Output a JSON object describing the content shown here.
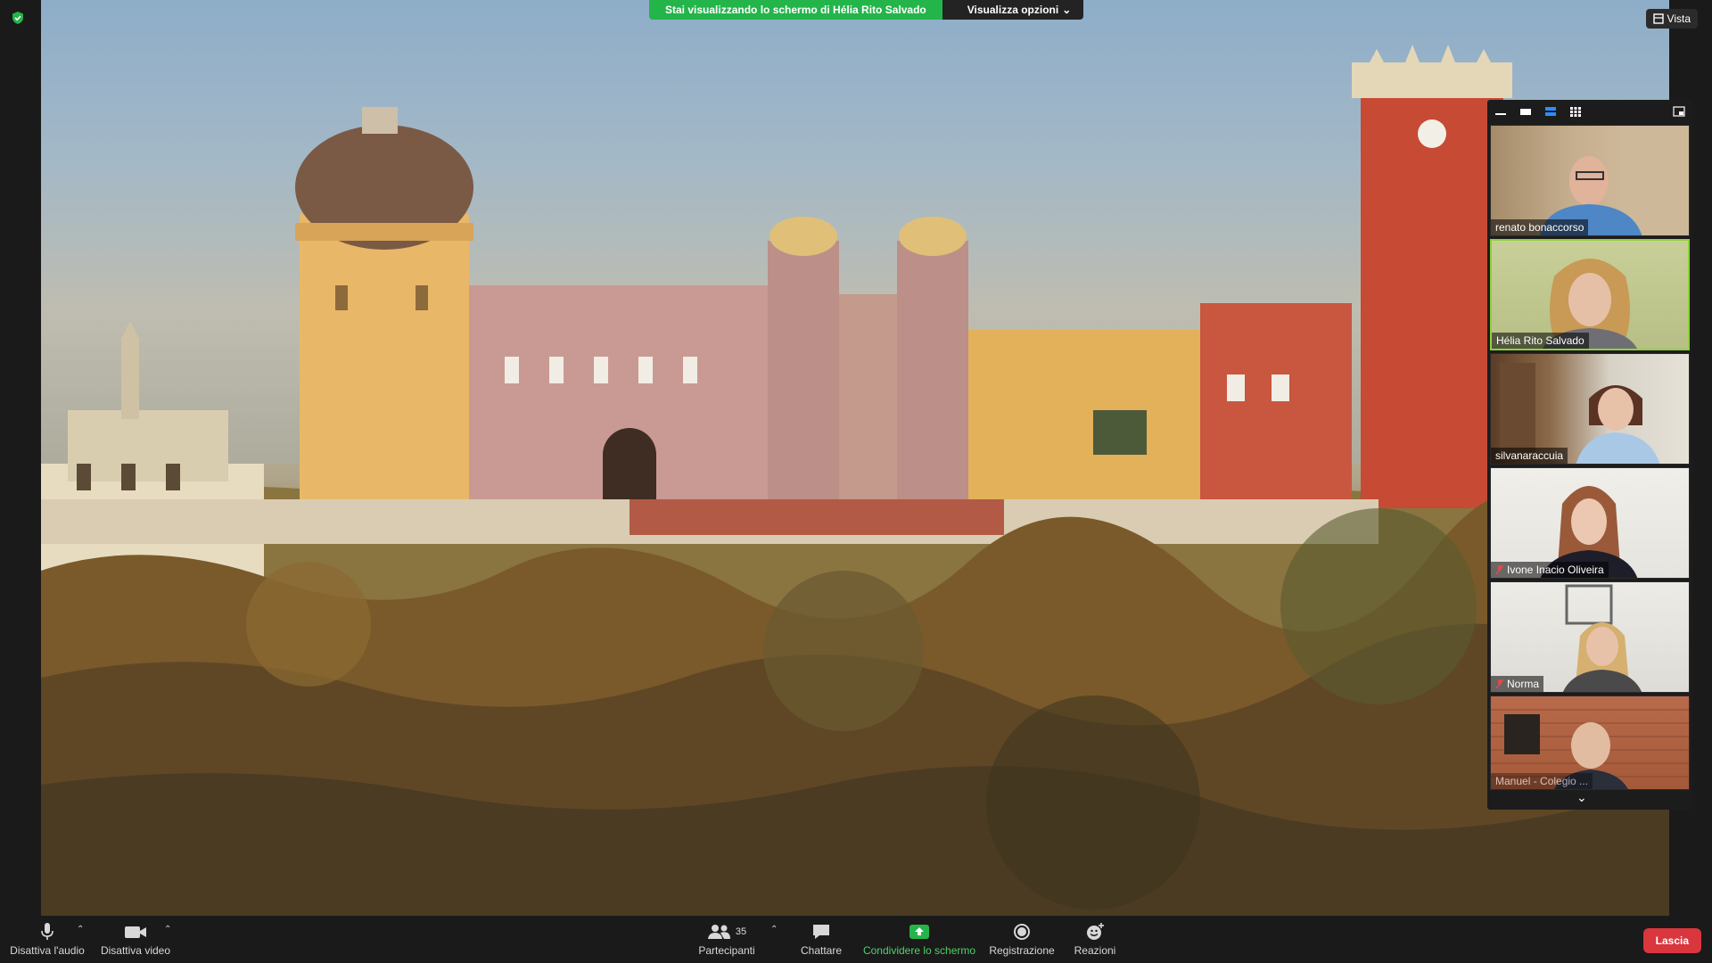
{
  "banner": {
    "sharing_text": "Stai visualizzando lo schermo di Hélia Rito Salvado",
    "options_label": "Visualizza opzioni"
  },
  "view_button": {
    "label": "Vista"
  },
  "gallery": {
    "participants": [
      {
        "name": "renato bonaccorso",
        "muted": false,
        "active": false
      },
      {
        "name": "Hélia Rito Salvado",
        "muted": false,
        "active": true
      },
      {
        "name": "silvanaraccuia",
        "muted": false,
        "active": false
      },
      {
        "name": "Ivone Inacio Oliveira",
        "muted": true,
        "active": false
      },
      {
        "name": "Norma",
        "muted": true,
        "active": false
      },
      {
        "name": "Manuel - Colegio ...",
        "muted": false,
        "active": false
      }
    ]
  },
  "toolbar": {
    "mute_audio": "Disattiva l'audio",
    "stop_video": "Disattiva video",
    "participants": "Partecipanti",
    "participants_count": "35",
    "chat": "Chattare",
    "share_screen": "Condividere lo schermo",
    "record": "Registrazione",
    "reactions": "Reazioni",
    "leave": "Lascia"
  },
  "colors": {
    "share_green": "#23b54a",
    "leave_red": "#d9363e",
    "active_speaker": "#8fd13a"
  }
}
